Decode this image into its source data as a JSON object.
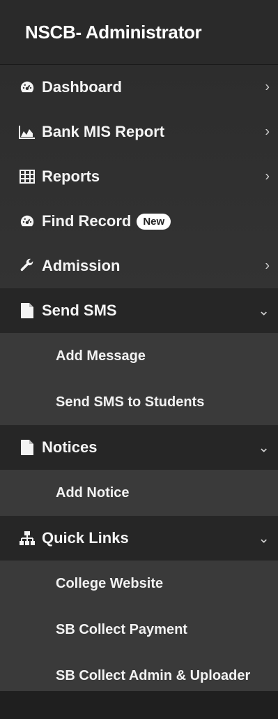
{
  "brand": {
    "title": "NSCB- Administrator"
  },
  "menu": {
    "dashboard": {
      "label": "Dashboard",
      "icon": "dashboard-icon"
    },
    "bank_mis": {
      "label": "Bank MIS Report",
      "icon": "area-chart-icon"
    },
    "reports": {
      "label": "Reports",
      "icon": "table-icon"
    },
    "find_record": {
      "label": "Find Record",
      "badge": "New",
      "icon": "dashboard-icon"
    },
    "admission": {
      "label": "Admission",
      "icon": "wrench-icon"
    },
    "send_sms": {
      "label": "Send SMS",
      "icon": "file-icon",
      "children": [
        "Add Message",
        "Send SMS to Students"
      ]
    },
    "notices": {
      "label": "Notices",
      "icon": "file-icon",
      "children": [
        "Add Notice"
      ]
    },
    "quick_links": {
      "label": "Quick Links",
      "icon": "sitemap-icon",
      "children": [
        "College Website",
        "SB Collect Payment",
        "SB Collect Admin & Uploader"
      ]
    }
  }
}
